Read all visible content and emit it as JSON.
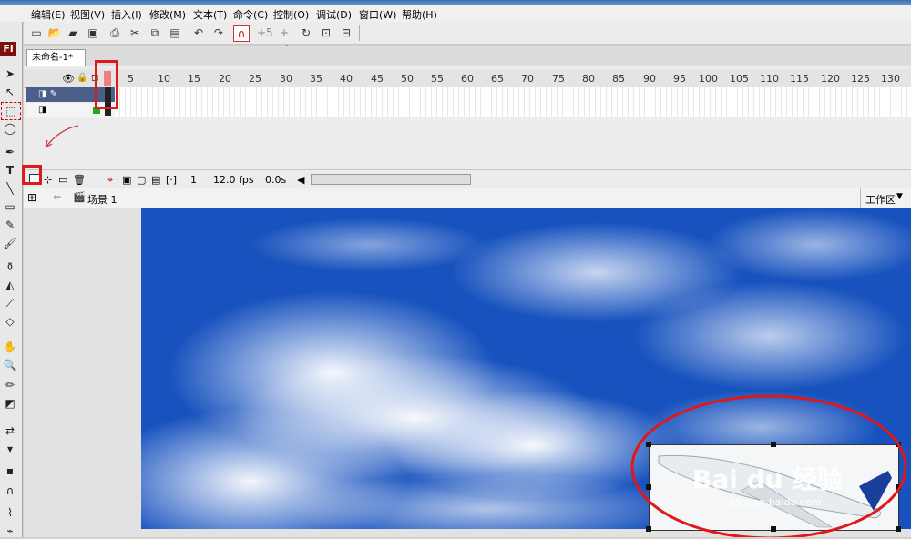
{
  "menu": [
    "编辑(E)",
    "视图(V)",
    "插入(I)",
    "修改(M)",
    "文本(T)",
    "命令(C)",
    "控制(O)",
    "调试(D)",
    "窗口(W)",
    "帮助(H)"
  ],
  "document_tab": "未命名-1*",
  "timeline": {
    "frame_numbers": [
      "5",
      "10",
      "15",
      "20",
      "25",
      "30",
      "35",
      "40",
      "45",
      "50",
      "55",
      "60",
      "65",
      "70",
      "75",
      "80",
      "85",
      "90",
      "95",
      "100",
      "105",
      "110",
      "115",
      "120",
      "125",
      "130"
    ],
    "current_frame": "1",
    "fps": "12.0 fps",
    "elapsed": "0.0s"
  },
  "editbar": {
    "scene": "场景 1",
    "workspace": "工作区"
  },
  "watermark": {
    "main": "Bai du 经验",
    "url": "jingyan.baidu.com"
  },
  "colors": {
    "annotation": "#e01818",
    "sky": "#1e5cc8"
  }
}
